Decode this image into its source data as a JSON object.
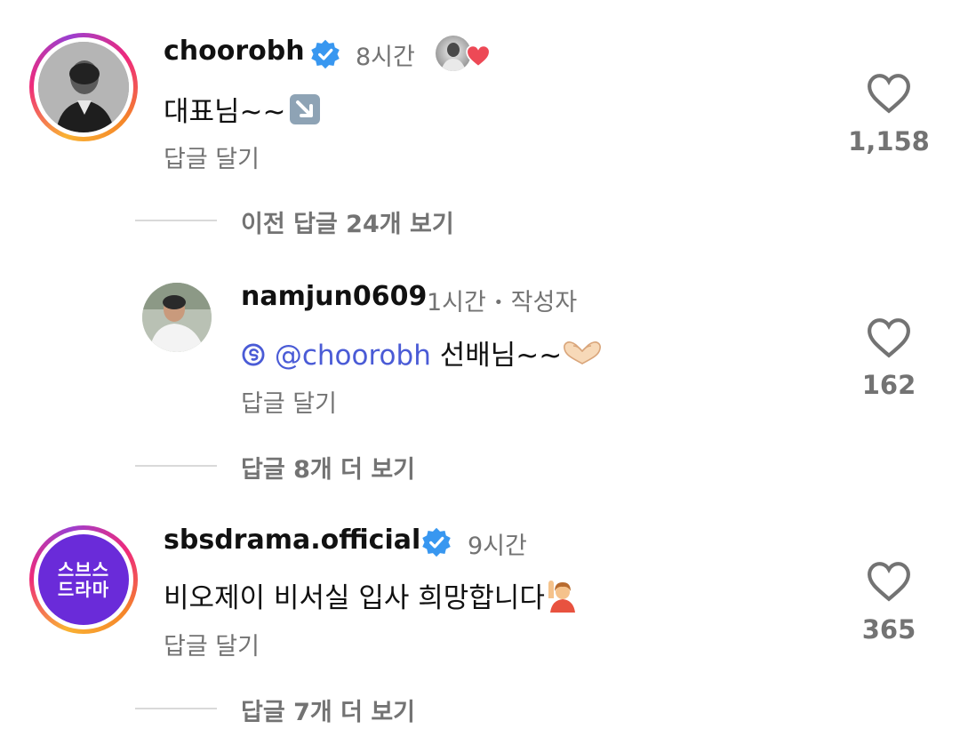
{
  "comments": [
    {
      "username": "choorobh",
      "verified": true,
      "time": "8시간",
      "text": "대표님~~",
      "text_emoji": "↘️",
      "reply_label": "답글 달기",
      "likes": "1,158",
      "view_replies": "이전 답글 24개 보기"
    },
    {
      "username": "namjun0609",
      "time": "1시간",
      "separator": "•",
      "author_tag": "작성자",
      "mention": "@choorobh",
      "text": "선배님~~",
      "reply_label": "답글 달기",
      "likes": "162",
      "view_replies": "답글 8개 더 보기"
    },
    {
      "username": "sbsdrama.official",
      "verified": true,
      "time": "9시간",
      "text": "비오제이 비서실 입사 희망합니다",
      "reply_label": "답글 달기",
      "likes": "365",
      "view_replies": "답글 7개 더 보기",
      "avatar_logo_line1": "스브스",
      "avatar_logo_line2": "드라마"
    }
  ],
  "colors": {
    "verified_blue": "#3897f0",
    "mention_blue": "#4a5bd6",
    "heart_red": "#ed4956",
    "sbs_purple": "#6a2bd9"
  }
}
